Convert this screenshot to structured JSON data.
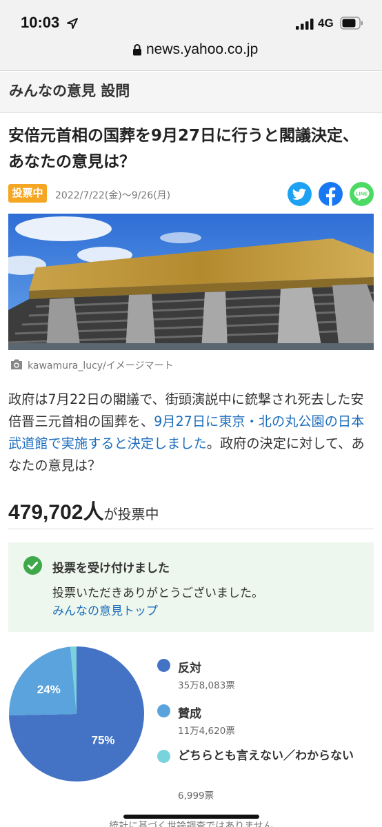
{
  "status_bar": {
    "time": "10:03",
    "network": "4G"
  },
  "browser": {
    "url": "news.yahoo.co.jp"
  },
  "section": {
    "title": "みんなの意見 設問"
  },
  "question": {
    "title": "安倍元首相の国葬を9月27日に行うと閣議決定、あなたの意見は？"
  },
  "meta": {
    "badge": "投票中",
    "period": "2022/7/22(金)〜9/26(月)"
  },
  "share": [
    {
      "icon": "twitter-icon",
      "color": "#1da1f2"
    },
    {
      "icon": "facebook-icon",
      "color": "#1877f2"
    },
    {
      "icon": "line-icon",
      "color": "#4cd964",
      "text": "LINE"
    }
  ],
  "image": {
    "credit": "kawamura_lucy/イメージマート"
  },
  "body": {
    "part1": "政府は7月22日の閣議で、街頭演説中に銃撃され死去した安倍晋三元首相の国葬を、",
    "link": "9月27日に東京・北の丸公園の日本武道館で実施すると決定しました",
    "part2": "。政府の決定に対して、あなたの意見は？"
  },
  "votes": {
    "count": "479,702人",
    "suffix": "が投票中"
  },
  "notice": {
    "title": "投票を受け付けました",
    "text": "投票いただきありがとうございました。",
    "link": "みんなの意見トップ"
  },
  "chart_data": {
    "type": "pie",
    "categories": [
      "反対",
      "賛成",
      "どちらとも言えない／わからない"
    ],
    "values": [
      358083,
      114620,
      6999
    ],
    "vote_labels": [
      "35万8,083票",
      "11万4,620票",
      "6,999票"
    ],
    "percent_labels": [
      "75%",
      "24%",
      ""
    ],
    "colors": [
      "#4472c4",
      "#5ba3dc",
      "#79d3dc"
    ]
  },
  "footer": {
    "note": "統計に基づく世論調査ではありません"
  }
}
